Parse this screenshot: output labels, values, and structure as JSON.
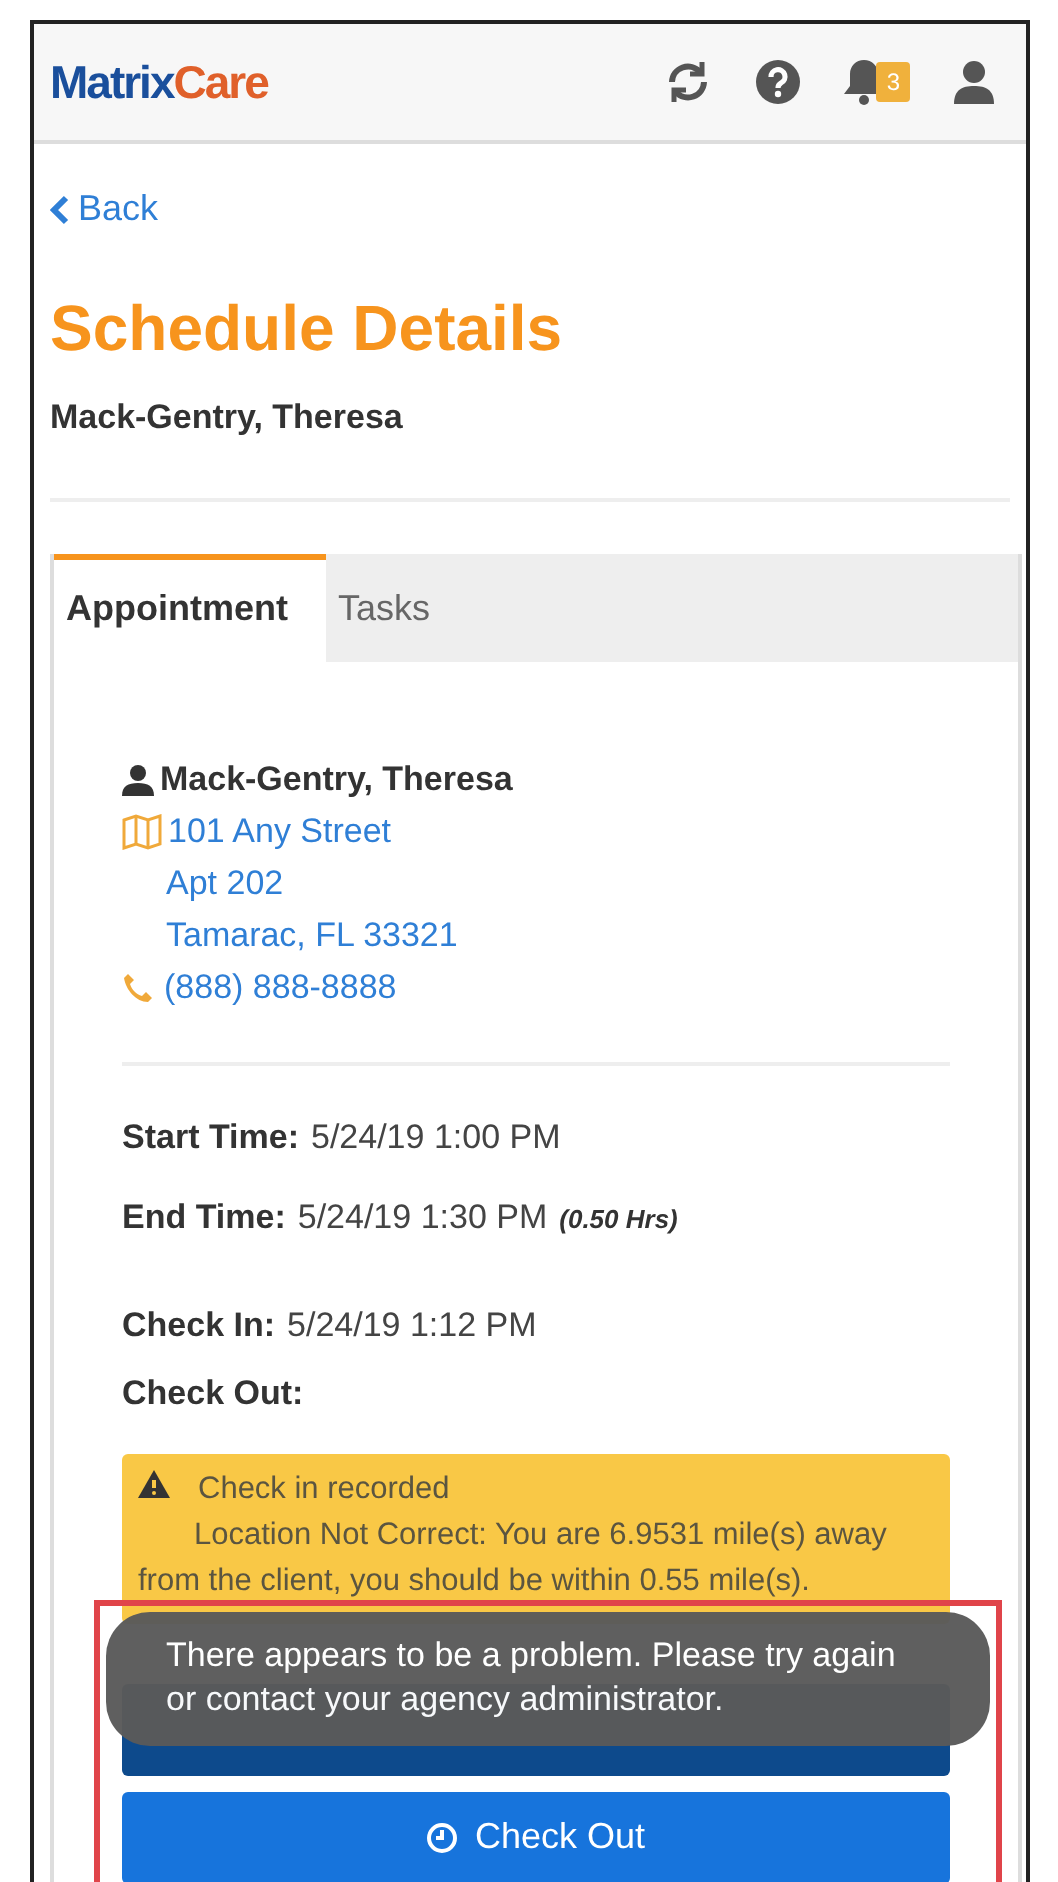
{
  "header": {
    "logo": {
      "first": "Matrix",
      "second": "Care"
    },
    "notification_count": "3"
  },
  "back_link": "Back",
  "title": "Schedule Details",
  "client_name": "Mack-Gentry, Theresa",
  "tabs": [
    {
      "label": "Appointment",
      "selected": true
    },
    {
      "label": "Tasks",
      "selected": false
    }
  ],
  "client": {
    "name": "Mack-Gentry, Theresa",
    "address_lines": [
      "101 Any Street",
      "Apt 202",
      "Tamarac, FL 33321"
    ],
    "phone": "(888) 888-8888"
  },
  "times": [
    {
      "label": "Start Time:",
      "value": "5/24/19 1:00 PM"
    },
    {
      "label": "End Time:",
      "value": "5/24/19 1:30 PM",
      "note": "(0.50 Hrs)"
    }
  ],
  "checks": [
    {
      "label": "Check In:",
      "value": "5/24/19 1:12 PM"
    },
    {
      "label": "Check Out:"
    }
  ],
  "alert": {
    "title": "Check in recorded",
    "message": "Location Not Correct: You are 6.9531 mile(s) away from the client, you should be within 0.55 mile(s)."
  },
  "toast": {
    "message": "There appears to be a problem. Please try again or contact your agency administrator.",
    "highlighted": true
  },
  "check_out_button": "Check Out"
}
